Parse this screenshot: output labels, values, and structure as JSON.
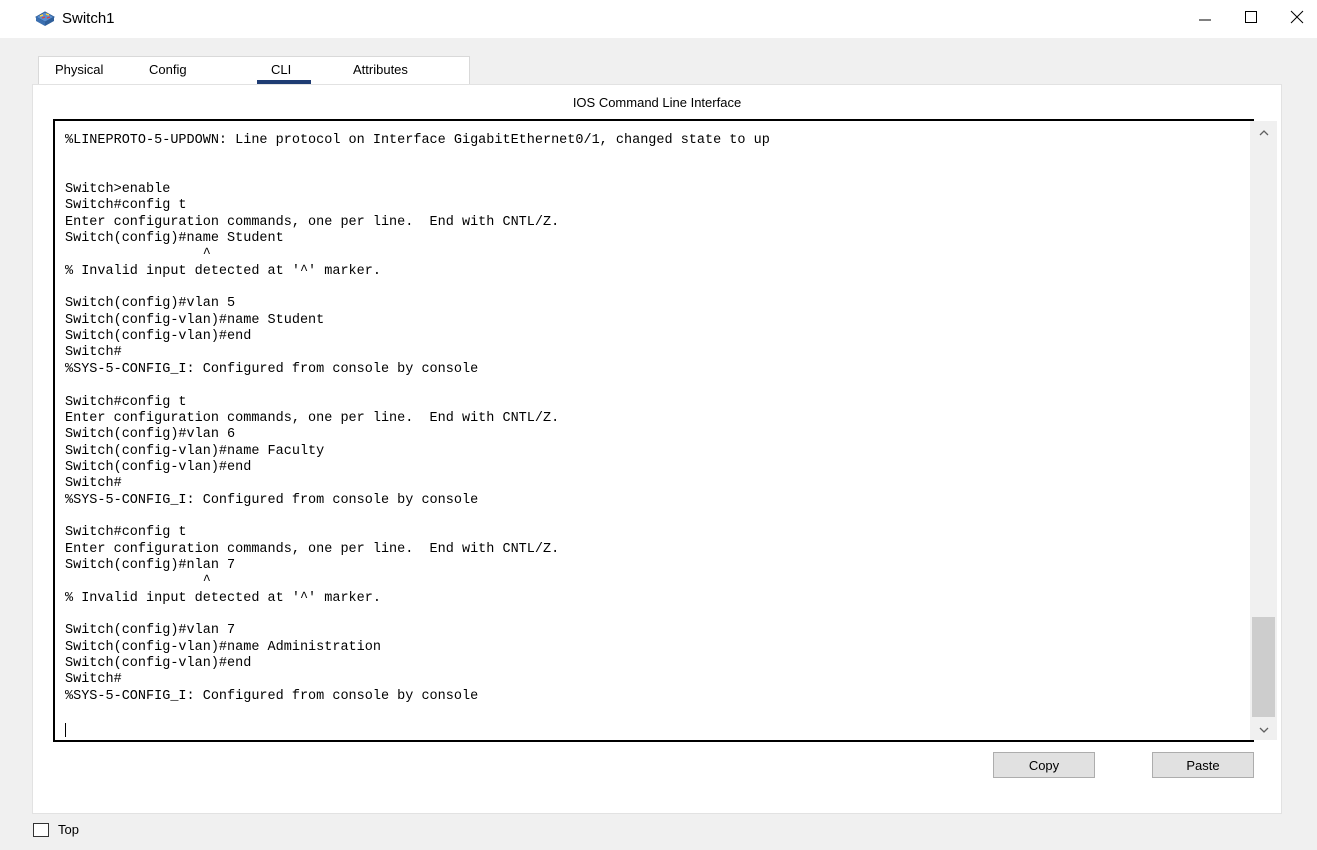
{
  "window": {
    "title": "Switch1",
    "controls": {
      "minimize_icon": "minimize-icon",
      "maximize_icon": "maximize-icon",
      "close_icon": "close-icon"
    }
  },
  "tabs": [
    {
      "label": "Physical"
    },
    {
      "label": "Config"
    },
    {
      "label": "CLI"
    },
    {
      "label": "Attributes"
    }
  ],
  "active_tab": "CLI",
  "panel": {
    "title": "IOS Command Line Interface"
  },
  "terminal": {
    "lines": [
      "%LINEPROTO-5-UPDOWN: Line protocol on Interface GigabitEthernet0/1, changed state to up",
      "",
      "",
      "Switch>enable",
      "Switch#config t",
      "Enter configuration commands, one per line.  End with CNTL/Z.",
      "Switch(config)#name Student",
      "                 ^",
      "% Invalid input detected at '^' marker.",
      "",
      "Switch(config)#vlan 5",
      "Switch(config-vlan)#name Student",
      "Switch(config-vlan)#end",
      "Switch#",
      "%SYS-5-CONFIG_I: Configured from console by console",
      "",
      "Switch#config t",
      "Enter configuration commands, one per line.  End with CNTL/Z.",
      "Switch(config)#vlan 6",
      "Switch(config-vlan)#name Faculty",
      "Switch(config-vlan)#end",
      "Switch#",
      "%SYS-5-CONFIG_I: Configured from console by console",
      "",
      "Switch#config t",
      "Enter configuration commands, one per line.  End with CNTL/Z.",
      "Switch(config)#nlan 7",
      "                 ^",
      "% Invalid input detected at '^' marker.",
      "",
      "Switch(config)#vlan 7",
      "Switch(config-vlan)#name Administration",
      "Switch(config-vlan)#end",
      "Switch#",
      "%SYS-5-CONFIG_I: Configured from console by console"
    ]
  },
  "buttons": {
    "copy_label": "Copy",
    "paste_label": "Paste"
  },
  "footer": {
    "top_label": "Top",
    "top_checked": false
  }
}
